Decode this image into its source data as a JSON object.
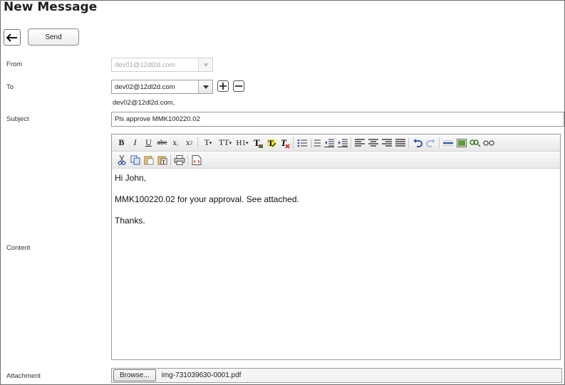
{
  "page": {
    "title": "New Message"
  },
  "actions": {
    "send_label": "Send"
  },
  "form": {
    "from": {
      "label": "From",
      "value": "dev01@12dl2d.com"
    },
    "to": {
      "label": "To",
      "value": "dev02@12dl2d.com",
      "recipients": "dev02@12dl2d.com,"
    },
    "subject": {
      "label": "Subject",
      "value": "Pls approve MMK100220.02"
    },
    "content": {
      "label": "Content",
      "lines": [
        "Hi John,",
        "MMK100220.02 for your approval. See attached.",
        "Thanks."
      ]
    },
    "attachment": {
      "label": "Attachment",
      "browse_label": "Browse...",
      "file_name": "img-731039630-0001.pdf"
    }
  },
  "toolbar": {
    "row1": [
      "bold-icon",
      "italic-icon",
      "underline-icon",
      "strikethrough-icon",
      "subscript-icon",
      "superscript-icon",
      "font-family-icon",
      "font-size-icon",
      "heading-icon",
      "text-color-icon",
      "highlight-icon",
      "clear-format-icon",
      "bulleted-list-icon",
      "numbered-list-icon",
      "outdent-icon",
      "indent-icon",
      "align-left-icon",
      "align-center-icon",
      "align-right-icon",
      "justify-icon",
      "undo-icon",
      "redo-icon",
      "horizontal-rule-icon",
      "insert-image-icon",
      "insert-link-icon",
      "unlink-icon"
    ],
    "row2": [
      "cut-icon",
      "copy-icon",
      "paste-icon",
      "paste-text-icon",
      "print-icon",
      "source-code-icon"
    ]
  }
}
